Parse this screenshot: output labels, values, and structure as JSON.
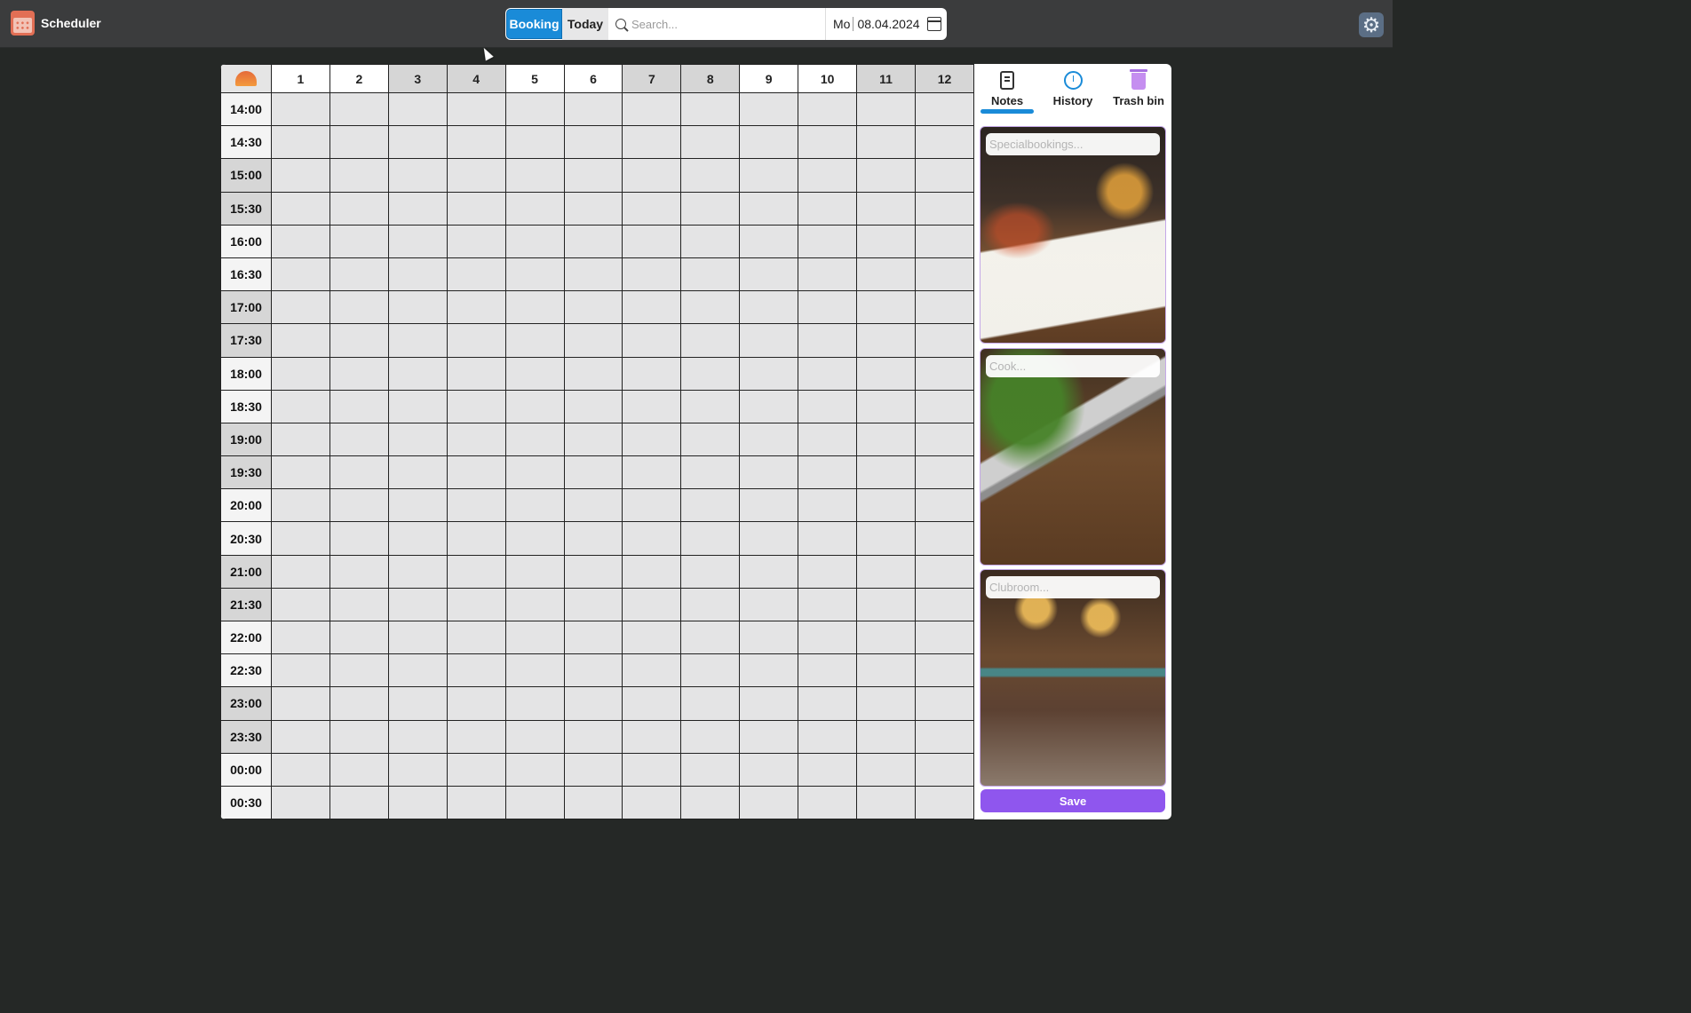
{
  "app": {
    "title": "Scheduler",
    "icon": "calendar-icon"
  },
  "toolbar": {
    "booking_label": "Booking",
    "today_label": "Today",
    "search_placeholder": "Search...",
    "date_day": "Mo",
    "date_value": "08.04.2024",
    "settings_icon": "gear-icon"
  },
  "grid": {
    "corner_icon": "sunset-icon",
    "columns": [
      "1",
      "2",
      "3",
      "4",
      "5",
      "6",
      "7",
      "8",
      "9",
      "10",
      "11",
      "12"
    ],
    "times": [
      "14:00",
      "14:30",
      "15:00",
      "15:30",
      "16:00",
      "16:30",
      "17:00",
      "17:30",
      "18:00",
      "18:30",
      "19:00",
      "19:30",
      "20:00",
      "20:30",
      "21:00",
      "21:30",
      "22:00",
      "22:30",
      "23:00",
      "23:30",
      "00:00",
      "00:30"
    ]
  },
  "sidebar": {
    "tabs": [
      {
        "label": "Notes",
        "icon": "notes-icon",
        "active": true
      },
      {
        "label": "History",
        "icon": "clock-icon",
        "active": false
      },
      {
        "label": "Trash bin",
        "icon": "trash-icon",
        "active": false
      }
    ],
    "notes": [
      {
        "placeholder": "Specialbookings..."
      },
      {
        "placeholder": "Cook..."
      },
      {
        "placeholder": "Clubroom..."
      }
    ],
    "save_label": "Save"
  },
  "colors": {
    "accent": "#1a8bd8",
    "save": "#8f56ee",
    "background": "#252826",
    "topbar": "#3b3c3d"
  }
}
